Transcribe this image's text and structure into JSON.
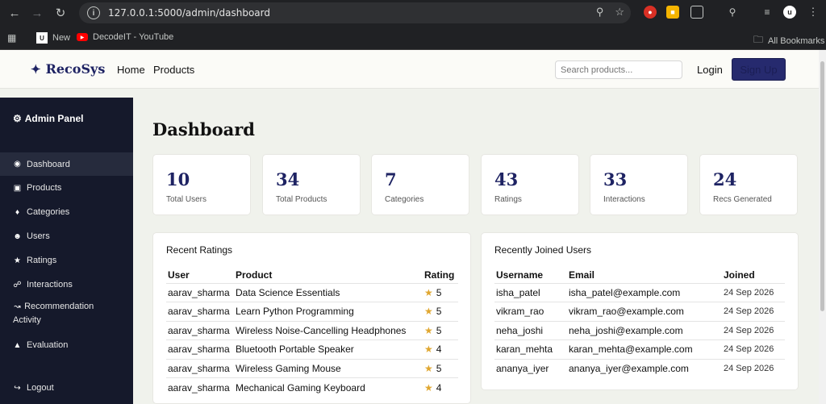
{
  "browser": {
    "url": "127.0.0.1:5000/admin/dashboard",
    "bookmarks": [
      "New",
      "DecodeIT - YouTube"
    ],
    "all_bookmarks": "All Bookmarks"
  },
  "nav": {
    "brand": "RecoSys",
    "links": [
      "Home",
      "Products"
    ],
    "search_placeholder": "Search products...",
    "login": "Login",
    "signup": "Sign Up"
  },
  "sidebar": {
    "title": "Admin Panel",
    "items": [
      {
        "label": "Dashboard",
        "icon": "palette-icon"
      },
      {
        "label": "Products",
        "icon": "box-icon"
      },
      {
        "label": "Categories",
        "icon": "tags-icon"
      },
      {
        "label": "Users",
        "icon": "users-icon"
      },
      {
        "label": "Ratings",
        "icon": "star-icon"
      },
      {
        "label": "Interactions",
        "icon": "network-icon"
      },
      {
        "label": "Recommendation Activity",
        "icon": "chart-line-icon"
      },
      {
        "label": "Evaluation",
        "icon": "flask-icon"
      }
    ],
    "logout": "Logout"
  },
  "dashboard": {
    "title": "Dashboard",
    "stats": [
      {
        "value": "10",
        "label": "Total Users"
      },
      {
        "value": "34",
        "label": "Total Products"
      },
      {
        "value": "7",
        "label": "Categories"
      },
      {
        "value": "43",
        "label": "Ratings"
      },
      {
        "value": "33",
        "label": "Interactions"
      },
      {
        "value": "24",
        "label": "Recs Generated"
      }
    ]
  },
  "recent_ratings": {
    "title": "Recent Ratings",
    "headers": [
      "User",
      "Product",
      "Rating"
    ],
    "rows": [
      {
        "user": "aarav_sharma",
        "product": "Data Science Essentials",
        "rating": "5"
      },
      {
        "user": "aarav_sharma",
        "product": "Learn Python Programming",
        "rating": "5"
      },
      {
        "user": "aarav_sharma",
        "product": "Wireless Noise-Cancelling Headphones",
        "rating": "5"
      },
      {
        "user": "aarav_sharma",
        "product": "Bluetooth Portable Speaker",
        "rating": "4"
      },
      {
        "user": "aarav_sharma",
        "product": "Wireless Gaming Mouse",
        "rating": "5"
      },
      {
        "user": "aarav_sharma",
        "product": "Mechanical Gaming Keyboard",
        "rating": "4"
      }
    ]
  },
  "recent_users": {
    "title": "Recently Joined Users",
    "headers": [
      "Username",
      "Email",
      "Joined"
    ],
    "rows": [
      {
        "username": "isha_patel",
        "email": "isha_patel@example.com",
        "joined": "24 Sep 2026"
      },
      {
        "username": "vikram_rao",
        "email": "vikram_rao@example.com",
        "joined": "24 Sep 2026"
      },
      {
        "username": "neha_joshi",
        "email": "neha_joshi@example.com",
        "joined": "24 Sep 2026"
      },
      {
        "username": "karan_mehta",
        "email": "karan_mehta@example.com",
        "joined": "24 Sep 2026"
      },
      {
        "username": "ananya_iyer",
        "email": "ananya_iyer@example.com",
        "joined": "24 Sep 2026"
      }
    ]
  }
}
